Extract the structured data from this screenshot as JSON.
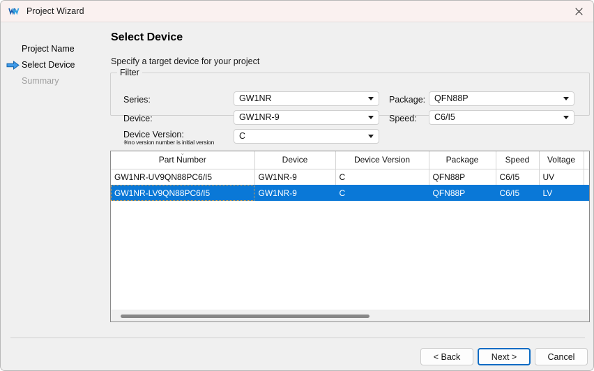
{
  "window": {
    "title": "Project Wizard",
    "app_icon": "gowin-logo-icon",
    "close_label": "✕"
  },
  "sidebar": {
    "items": [
      {
        "label": "Project Name",
        "state": "done"
      },
      {
        "label": "Select Device",
        "state": "current"
      },
      {
        "label": "Summary",
        "state": "disabled"
      }
    ],
    "current_arrow_icon": "arrow-right-icon"
  },
  "page": {
    "title": "Select Device",
    "subtitle": "Specify a target device for your project"
  },
  "filter": {
    "legend": "Filter",
    "fields": [
      {
        "name": "series",
        "label": "Series:",
        "value": "GW1NR"
      },
      {
        "name": "device",
        "label": "Device:",
        "value": "GW1NR-9"
      },
      {
        "name": "device_version",
        "label": "Device Version:",
        "value": "C",
        "note": "※no version number is initial version"
      },
      {
        "name": "package",
        "label": "Package:",
        "value": "QFN88P"
      },
      {
        "name": "speed",
        "label": "Speed:",
        "value": "C6/I5"
      }
    ]
  },
  "table": {
    "columns": [
      "Part Number",
      "Device",
      "Device Version",
      "Package",
      "Speed",
      "Voltage",
      ""
    ],
    "sorted_column": "Part Number",
    "sort_indicator": "⌄",
    "rows": [
      {
        "selected": false,
        "cells": [
          "GW1NR-UV9QN88PC6/I5",
          "GW1NR-9",
          "C",
          "QFN88P",
          "C6/I5",
          "UV",
          ""
        ]
      },
      {
        "selected": true,
        "cells": [
          "GW1NR-LV9QN88PC6/I5",
          "GW1NR-9",
          "C",
          "QFN88P",
          "C6/I5",
          "LV",
          ""
        ]
      }
    ],
    "selection_color": "#0a78d7",
    "focus_outline_color": "#e8a33d"
  },
  "footer": {
    "buttons": [
      {
        "name": "back",
        "label": "< Back",
        "default": false
      },
      {
        "name": "next",
        "label": "Next >",
        "default": true
      },
      {
        "name": "cancel",
        "label": "Cancel",
        "default": false
      }
    ]
  }
}
